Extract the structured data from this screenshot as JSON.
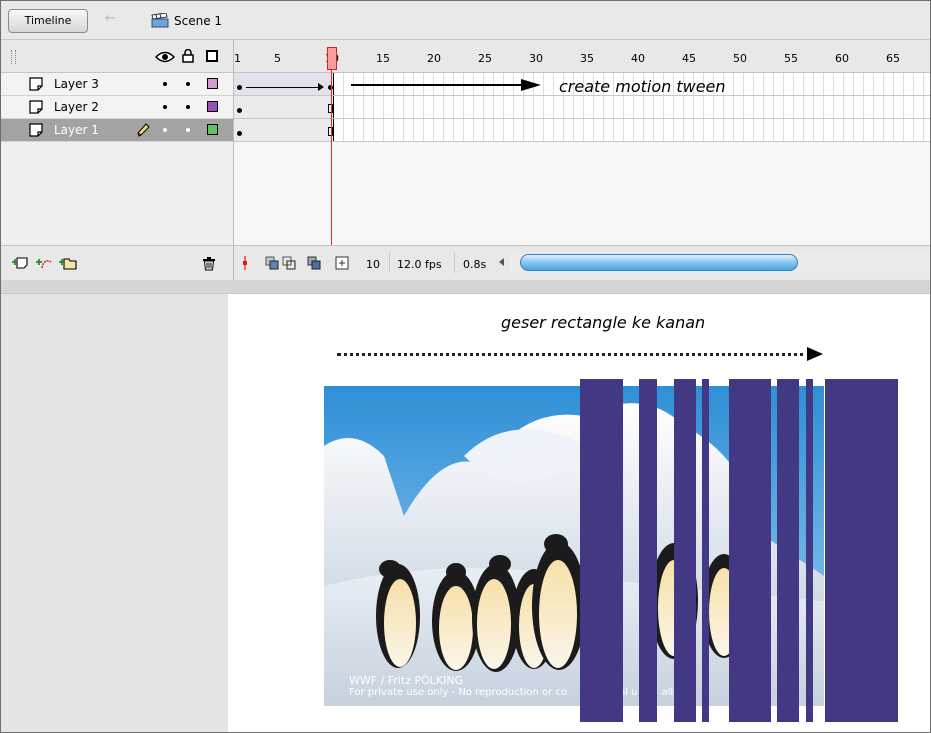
{
  "toolbar": {
    "timeline_label": "Timeline",
    "scene_label": "Scene 1",
    "back_icon": "back-arrow-icon",
    "scene_icon": "clapperboard-icon"
  },
  "timeline": {
    "header_icons": [
      "eye-icon",
      "lock-icon",
      "outline-icon"
    ],
    "frame_numbers": [
      "1",
      "5",
      "10",
      "15",
      "20",
      "25",
      "30",
      "35",
      "40",
      "45",
      "50",
      "55",
      "60",
      "65"
    ],
    "current_frame_marker": "10",
    "layers": [
      {
        "name": "Layer 3",
        "color": "#d59bd0",
        "selected": false,
        "keyframes": "motion tween 1-10"
      },
      {
        "name": "Layer 2",
        "color": "#9a52b8",
        "selected": false,
        "keyframes": "keyframe 1, end 10"
      },
      {
        "name": "Layer 1",
        "color": "#5fc15f",
        "selected": true,
        "keyframes": "keyframe 1, end 10"
      }
    ],
    "footer": {
      "current_frame": "10",
      "frame_rate": "12.0 fps",
      "elapsed": "0.8s",
      "scroll_thumb_fraction": 0.66
    },
    "footer_icons": [
      "add-layer-icon",
      "add-motion-guide-icon",
      "insert-folder-icon",
      "trash-icon",
      "center-frame-icon",
      "onion-skin-icon",
      "onion-skin-outlines-icon",
      "edit-multiple-frames-icon",
      "modify-onion-markers-icon"
    ]
  },
  "annotations": {
    "create_tween": "create motion tween",
    "move_rect": "geser rectangle ke kanan"
  },
  "stage": {
    "photo_credit_line1": "WWF / Fritz PÖLKING",
    "photo_credit_line2": "For private use only - No reproduction or co",
    "photo_credit_line2_end": "al u",
    "photo_credit_line2_tail": "allo",
    "stripe_color": "#423883"
  }
}
